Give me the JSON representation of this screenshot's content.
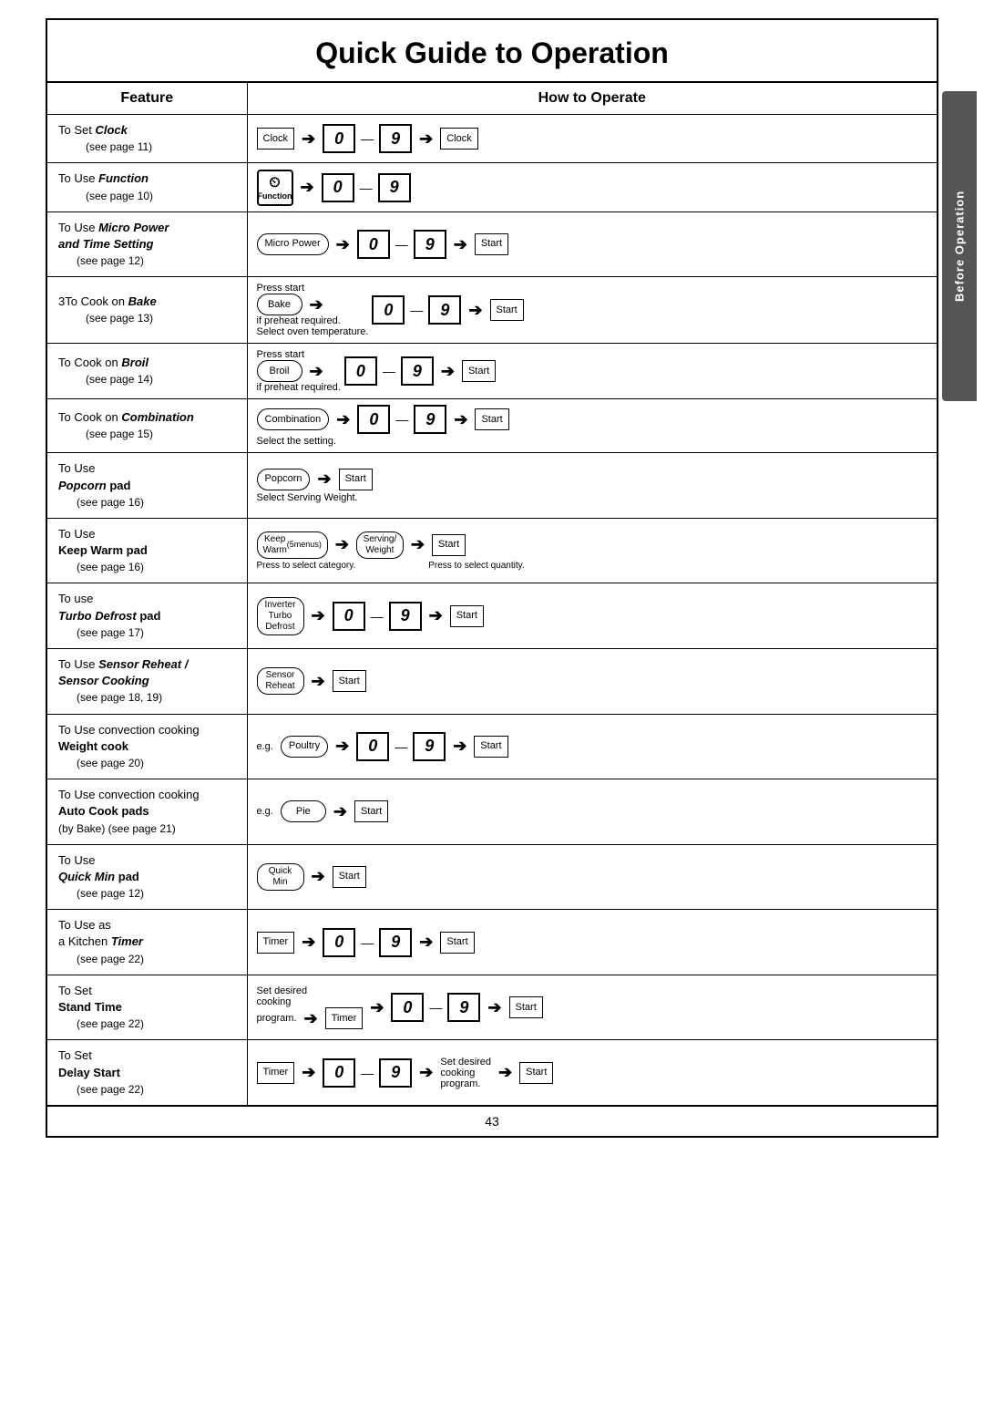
{
  "title": "Quick Guide to Operation",
  "side_tab": "Before Operation",
  "headers": {
    "feature": "Feature",
    "operation": "How to Operate"
  },
  "page_number": "43",
  "rows": [
    {
      "id": "set-clock",
      "feature_prefix": "To Set ",
      "feature_bold": "Clock",
      "feature_suffix": "",
      "feature_page": "(see page 11)"
    },
    {
      "id": "use-function",
      "feature_prefix": "To Use ",
      "feature_bold": "Function",
      "feature_suffix": "",
      "feature_page": "(see page 10)"
    },
    {
      "id": "micro-power",
      "feature_prefix": "To Use ",
      "feature_bold": "Micro Power\nand Time Setting",
      "feature_suffix": "",
      "feature_page": "(see page 12)"
    },
    {
      "id": "bake",
      "feature_prefix": "3To Cook on ",
      "feature_bold": "Bake",
      "feature_suffix": "",
      "feature_page": "(see page 13)"
    },
    {
      "id": "broil",
      "feature_prefix": "To Cook on ",
      "feature_bold": "Broil",
      "feature_suffix": "",
      "feature_page": "(see page 14)"
    },
    {
      "id": "combination",
      "feature_prefix": "To Cook on ",
      "feature_bold": "Combination",
      "feature_suffix": "",
      "feature_page": "(see page 15)"
    },
    {
      "id": "popcorn",
      "feature_prefix": "To Use\n",
      "feature_bold": "Popcorn",
      "feature_suffix": " pad",
      "feature_page": "(see page 16)"
    },
    {
      "id": "keep-warm",
      "feature_prefix": "To Use\n",
      "feature_bold": "Keep Warm",
      "feature_suffix": " pad",
      "feature_page": "(see page 16)"
    },
    {
      "id": "turbo-defrost",
      "feature_prefix": "To use\n",
      "feature_bold": "Turbo Defrost",
      "feature_suffix": " pad",
      "feature_page": "(see page 17)"
    },
    {
      "id": "sensor-reheat",
      "feature_prefix": "To Use ",
      "feature_bold": "Sensor Reheat /\nSensor Cooking",
      "feature_suffix": "",
      "feature_page": "(see page 18, 19)"
    },
    {
      "id": "weight-cook",
      "feature_prefix": "To Use convection cooking\n",
      "feature_bold": "Weight cook",
      "feature_suffix": "",
      "feature_page": "(see page 20)"
    },
    {
      "id": "auto-cook",
      "feature_prefix": "To Use convection cooking\n",
      "feature_bold": "Auto Cook pads",
      "feature_suffix": "",
      "feature_page": "(by Bake) (see page 21)"
    },
    {
      "id": "quick-min",
      "feature_prefix": "To Use\n",
      "feature_bold": "Quick Min",
      "feature_suffix": " pad",
      "feature_page": "(see page 12)"
    },
    {
      "id": "kitchen-timer",
      "feature_prefix": "To Use as\na Kitchen ",
      "feature_bold": "Timer",
      "feature_suffix": "",
      "feature_page": "(see page 22)"
    },
    {
      "id": "stand-time",
      "feature_prefix": "To Set\n",
      "feature_bold": "Stand Time",
      "feature_suffix": "",
      "feature_page": "(see page 22)"
    },
    {
      "id": "delay-start",
      "feature_prefix": "To Set\n",
      "feature_bold": "Delay Start",
      "feature_suffix": "",
      "feature_page": "(see page 22)"
    }
  ]
}
